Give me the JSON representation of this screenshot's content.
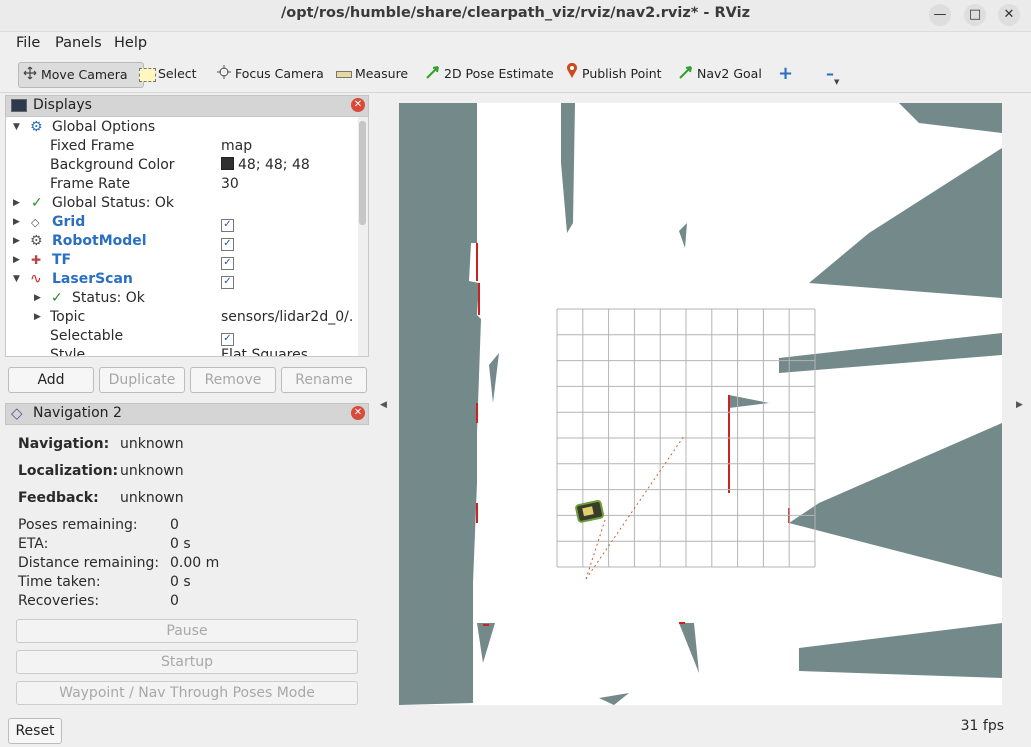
{
  "window": {
    "title": "/opt/ros/humble/share/clearpath_viz/rviz/nav2.rviz* - RViz"
  },
  "menu": [
    "File",
    "Panels",
    "Help"
  ],
  "toolbar": {
    "move_camera": "Move Camera",
    "select": "Select",
    "focus_camera": "Focus Camera",
    "measure": "Measure",
    "pose_estimate": "2D Pose Estimate",
    "publish_point": "Publish Point",
    "nav2_goal": "Nav2 Goal"
  },
  "displays": {
    "header": "Displays",
    "rows": [
      {
        "name": "Global Options",
        "value": ""
      },
      {
        "name": "Fixed Frame",
        "value": "map"
      },
      {
        "name": "Background Color",
        "value": "48; 48; 48"
      },
      {
        "name": "Frame Rate",
        "value": "30"
      },
      {
        "name": "Global Status: Ok",
        "value": ""
      },
      {
        "name": "Grid",
        "value": ""
      },
      {
        "name": "RobotModel",
        "value": ""
      },
      {
        "name": "TF",
        "value": ""
      },
      {
        "name": "LaserScan",
        "value": ""
      },
      {
        "name": "Status: Ok",
        "value": ""
      },
      {
        "name": "Topic",
        "value": "sensors/lidar2d_0/."
      },
      {
        "name": "Selectable",
        "value": ""
      },
      {
        "name": "Style",
        "value": "Flat Squares"
      }
    ],
    "background_color_swatch": "#303030",
    "buttons": {
      "add": "Add",
      "duplicate": "Duplicate",
      "remove": "Remove",
      "rename": "Rename"
    }
  },
  "navigation": {
    "header": "Navigation 2",
    "status": [
      {
        "label": "Navigation:",
        "value": "unknown"
      },
      {
        "label": "Localization:",
        "value": "unknown"
      },
      {
        "label": "Feedback:",
        "value": "unknown"
      }
    ],
    "stats": [
      {
        "label": "Poses remaining:",
        "value": "0"
      },
      {
        "label": "ETA:",
        "value": "0 s"
      },
      {
        "label": "Distance remaining:",
        "value": "0.00 m"
      },
      {
        "label": "Time taken:",
        "value": "0 s"
      },
      {
        "label": "Recoveries:",
        "value": "0"
      }
    ],
    "buttons": {
      "pause": "Pause",
      "startup": "Startup",
      "waypoint": "Waypoint / Nav Through Poses Mode"
    }
  },
  "footer": {
    "reset": "Reset",
    "fps": "31 fps"
  },
  "colors": {
    "map_obstacle": "#73898a",
    "map_free": "#ffffff",
    "laser": "#cc2222",
    "grid": "#b4b4b4"
  }
}
